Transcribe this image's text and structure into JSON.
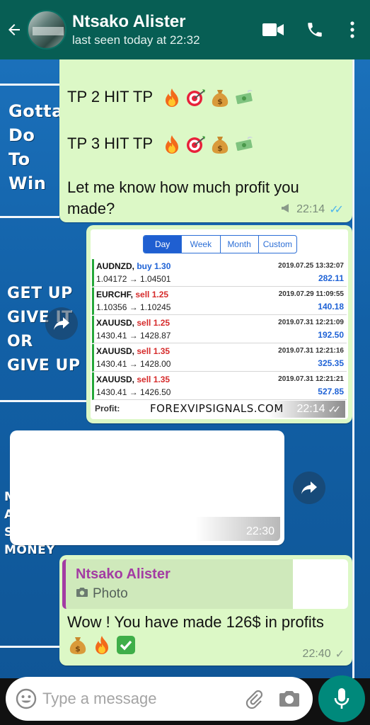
{
  "header": {
    "name": "Ntsako Alister",
    "status": "last seen today at 22:32"
  },
  "wallpaper": {
    "slogan1": "Gotta\nDo\nTo\nWin",
    "slogan2": "GET UP\nGIVE IT\nOR\nGIVE UP",
    "slogan3": "M\nA\nS\nMONEY"
  },
  "messages": {
    "m1": {
      "tp2": "TP 2 HIT TP",
      "tp3": "TP 3 HIT TP",
      "body": "Let me know how much profit you made?",
      "time": "22:14"
    },
    "m2": {
      "time": "22:14"
    },
    "m3": {
      "time": "22:30"
    },
    "m4": {
      "quote_name": "Ntsako Alister",
      "quote_type": "Photo",
      "body": "Wow ! You have made 126$ in profits",
      "time": "22:40"
    }
  },
  "trades": {
    "tabs": [
      "Day",
      "Week",
      "Month",
      "Custom"
    ],
    "rows": [
      {
        "symbol": "AUDNZD,",
        "side": "buy 1.30",
        "datetime": "2019.07.25 13:32:07",
        "prices": "1.04172 → 1.04501",
        "profit": "282.11"
      },
      {
        "symbol": "EURCHF,",
        "side": "sell 1.25",
        "datetime": "2019.07.29 11:09:55",
        "prices": "1.10356 → 1.10245",
        "profit": "140.18"
      },
      {
        "symbol": "XAUUSD,",
        "side": "sell 1.25",
        "datetime": "2019.07.31 12:21:09",
        "prices": "1430.41 → 1428.87",
        "profit": "192.50"
      },
      {
        "symbol": "XAUUSD,",
        "side": "sell 1.35",
        "datetime": "2019.07.31 12:21:16",
        "prices": "1430.41 → 1428.00",
        "profit": "325.35"
      },
      {
        "symbol": "XAUUSD,",
        "side": "sell 1.35",
        "datetime": "2019.07.31 12:21:21",
        "prices": "1430.41 → 1426.50",
        "profit": "527.85"
      }
    ],
    "profit_label": "Profit:",
    "watermark": "FOREXVIPSIGNALS.COM"
  },
  "input": {
    "placeholder": "Type a message"
  },
  "colors": {
    "header": "#075e54",
    "outgoing_bubble": "#dcf8c6",
    "incoming_bubble": "#ffffff",
    "read_ticks": "#4fb6ec",
    "mic_button": "#00897b"
  }
}
